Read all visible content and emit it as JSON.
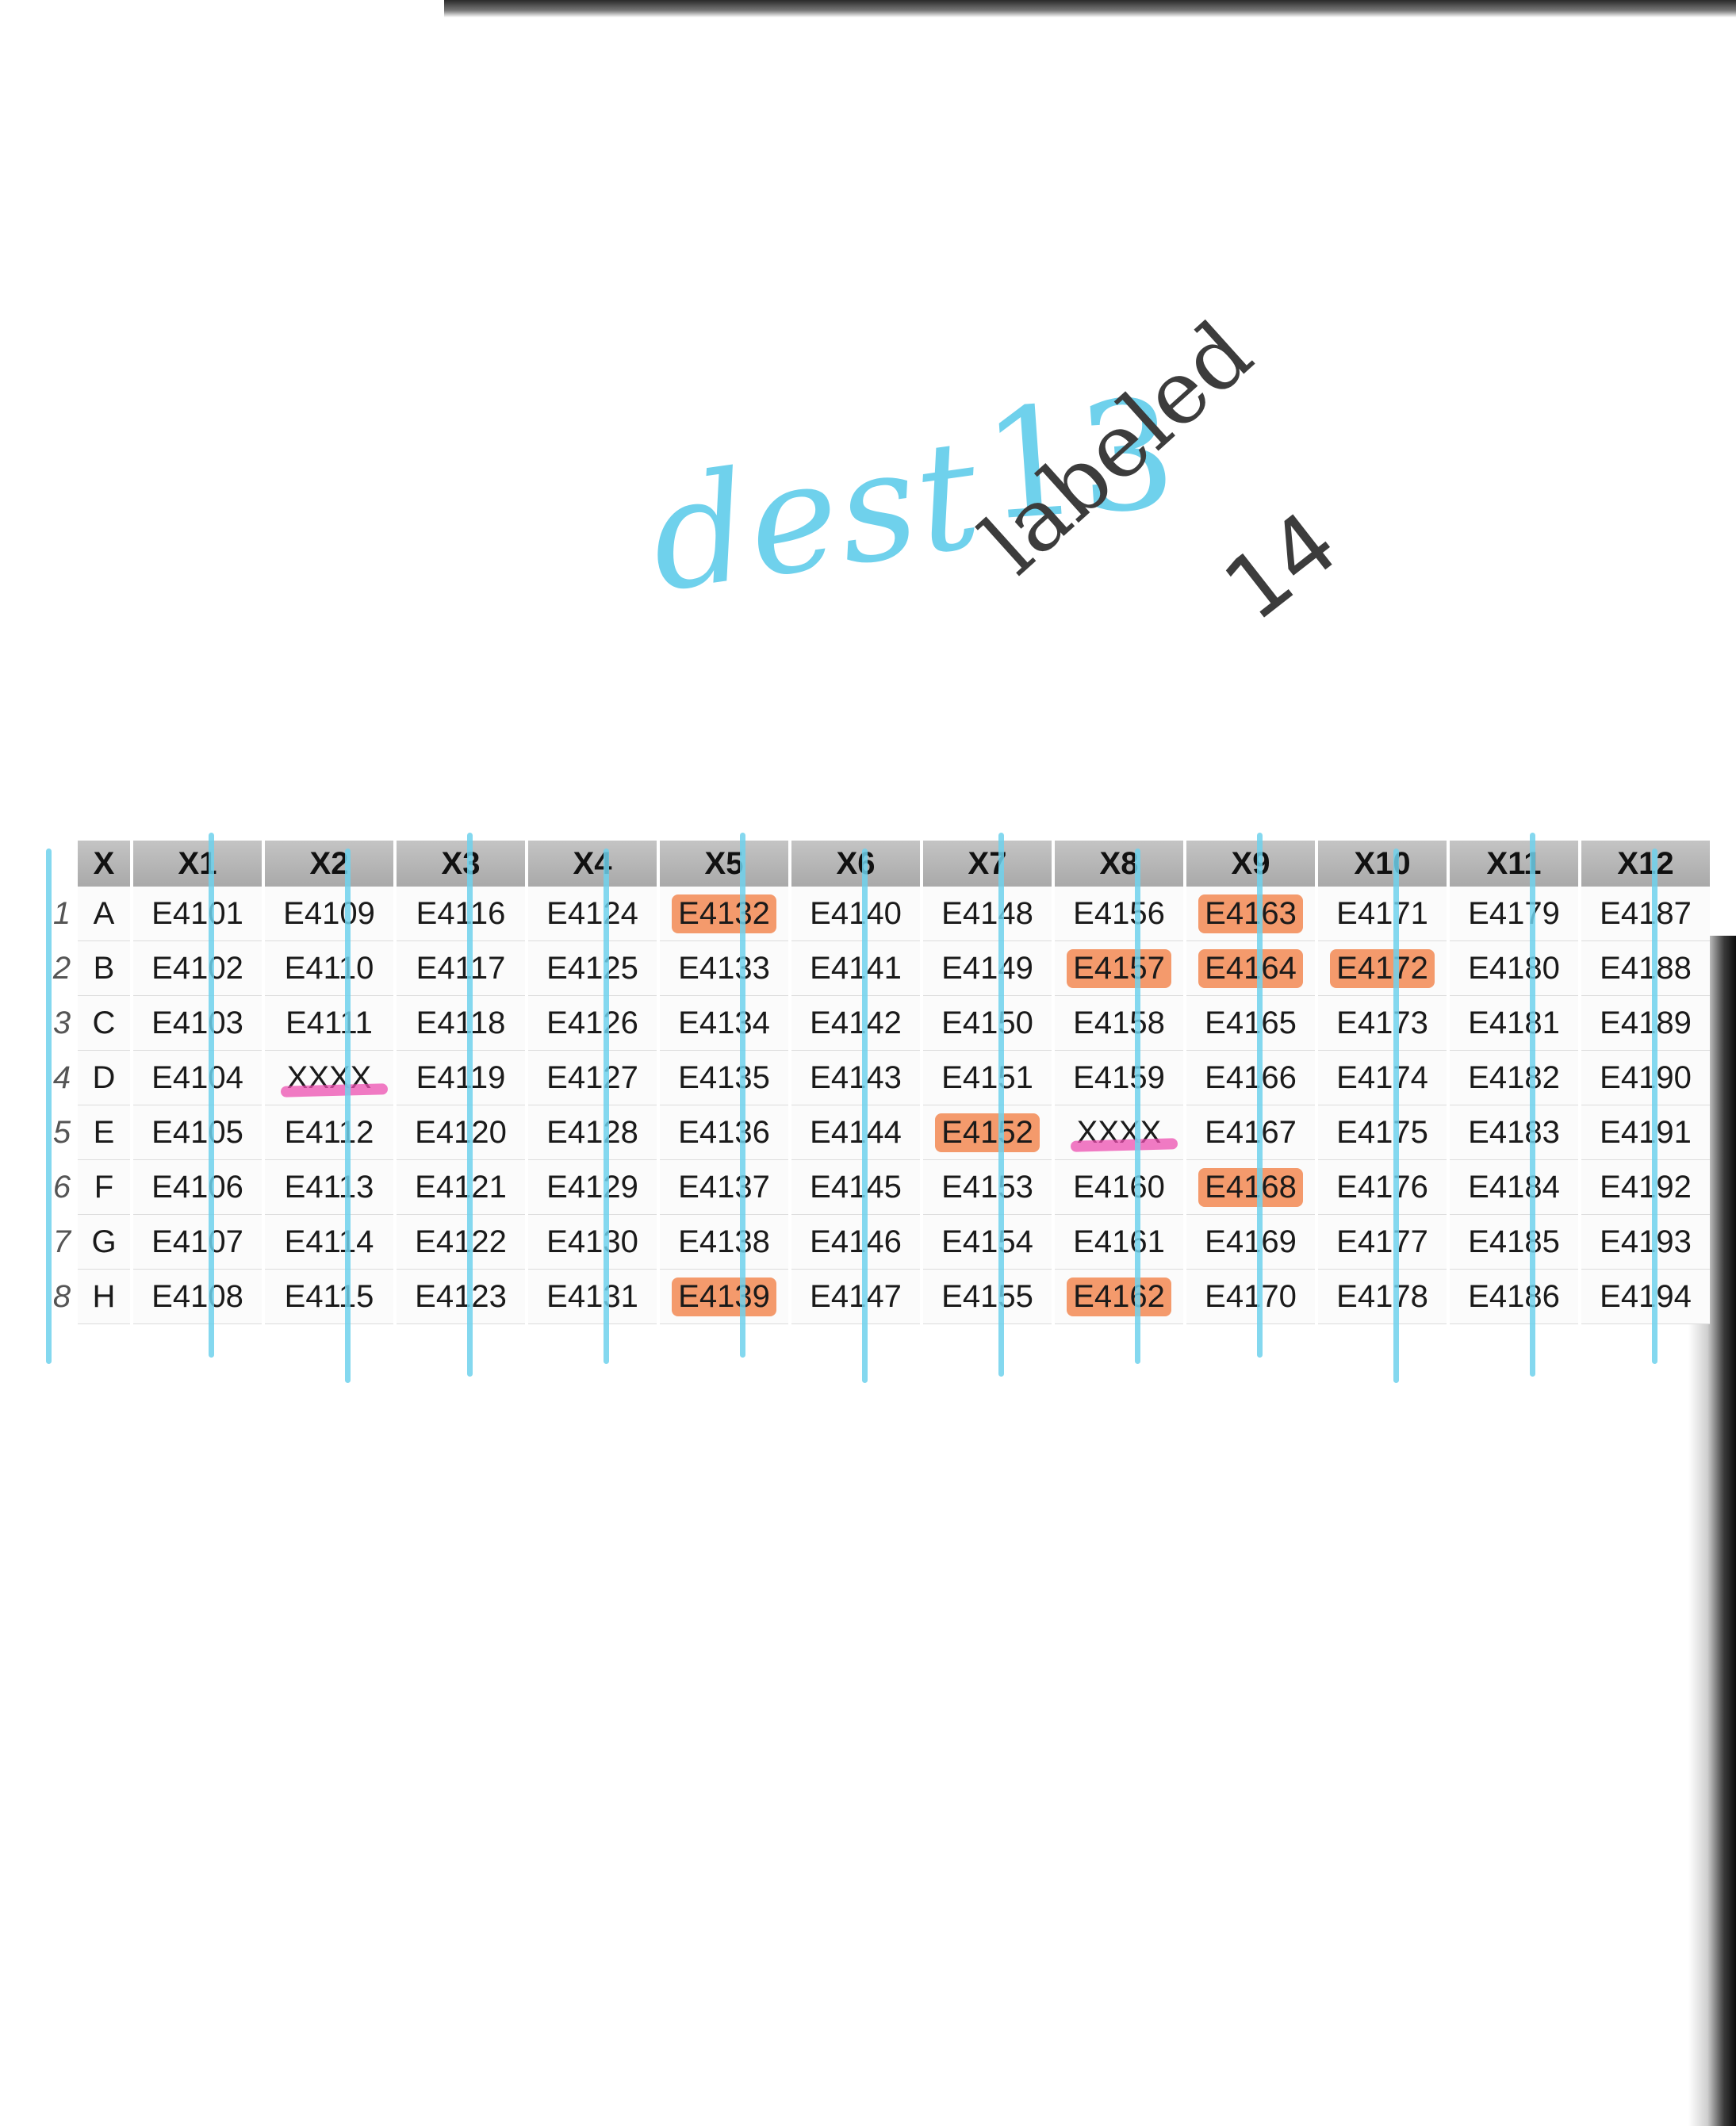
{
  "annotations": {
    "dest": "dest",
    "dest_number": "13",
    "labeled": "labeled",
    "labeled_number": "14"
  },
  "colors": {
    "blue_marker": "#6fd1ec",
    "orange_highlight": "#f49a6c",
    "pink_highlight": "#ec4fb0",
    "header_gray": "#b3b3b3",
    "pencil": "#3c3c3c"
  },
  "plate": {
    "corner_label": "X",
    "columns": [
      "X1",
      "X2",
      "X3",
      "X4",
      "X5",
      "X6",
      "X7",
      "X8",
      "X9",
      "X10",
      "X11",
      "X12"
    ],
    "rows": [
      {
        "num": "1",
        "letter": "A",
        "cells": [
          "E4101",
          "E4109",
          "E4116",
          "E4124",
          "E4132",
          "E4140",
          "E4148",
          "E4156",
          "E4163",
          "E4171",
          "E4179",
          "E4187"
        ],
        "highlight": [
          "",
          "",
          "",
          "",
          "orange",
          "",
          "",
          "",
          "orange",
          "",
          "",
          ""
        ]
      },
      {
        "num": "2",
        "letter": "B",
        "cells": [
          "E4102",
          "E4110",
          "E4117",
          "E4125",
          "E4133",
          "E4141",
          "E4149",
          "E4157",
          "E4164",
          "E4172",
          "E4180",
          "E4188"
        ],
        "highlight": [
          "",
          "",
          "",
          "",
          "",
          "",
          "",
          "orange",
          "orange",
          "orange",
          "",
          ""
        ]
      },
      {
        "num": "3",
        "letter": "C",
        "cells": [
          "E4103",
          "E4111",
          "E4118",
          "E4126",
          "E4134",
          "E4142",
          "E4150",
          "E4158",
          "E4165",
          "E4173",
          "E4181",
          "E4189"
        ],
        "highlight": [
          "",
          "",
          "",
          "",
          "",
          "",
          "",
          "",
          "",
          "",
          "",
          ""
        ]
      },
      {
        "num": "4",
        "letter": "D",
        "cells": [
          "E4104",
          "XXXX",
          "E4119",
          "E4127",
          "E4135",
          "E4143",
          "E4151",
          "E4159",
          "E4166",
          "E4174",
          "E4182",
          "E4190"
        ],
        "highlight": [
          "",
          "pink",
          "",
          "",
          "",
          "",
          "",
          "",
          "",
          "",
          "",
          ""
        ]
      },
      {
        "num": "5",
        "letter": "E",
        "cells": [
          "E4105",
          "E4112",
          "E4120",
          "E4128",
          "E4136",
          "E4144",
          "E4152",
          "XXXX",
          "E4167",
          "E4175",
          "E4183",
          "E4191"
        ],
        "highlight": [
          "",
          "",
          "",
          "",
          "",
          "",
          "orange",
          "pink",
          "",
          "",
          "",
          ""
        ]
      },
      {
        "num": "6",
        "letter": "F",
        "cells": [
          "E4106",
          "E4113",
          "E4121",
          "E4129",
          "E4137",
          "E4145",
          "E4153",
          "E4160",
          "E4168",
          "E4176",
          "E4184",
          "E4192"
        ],
        "highlight": [
          "",
          "",
          "",
          "",
          "",
          "",
          "",
          "",
          "orange",
          "",
          "",
          ""
        ]
      },
      {
        "num": "7",
        "letter": "G",
        "cells": [
          "E4107",
          "E4114",
          "E4122",
          "E4130",
          "E4138",
          "E4146",
          "E4154",
          "E4161",
          "E4169",
          "E4177",
          "E4185",
          "E4193"
        ],
        "highlight": [
          "",
          "",
          "",
          "",
          "",
          "",
          "",
          "",
          "",
          "",
          "",
          ""
        ]
      },
      {
        "num": "8",
        "letter": "H",
        "cells": [
          "E4108",
          "E4115",
          "E4123",
          "E4131",
          "E4139",
          "E4147",
          "E4155",
          "E4162",
          "E4170",
          "E4178",
          "E4186",
          "E4194"
        ],
        "highlight": [
          "",
          "",
          "",
          "",
          "orange",
          "",
          "",
          "orange",
          "",
          "",
          "",
          ""
        ]
      }
    ]
  }
}
